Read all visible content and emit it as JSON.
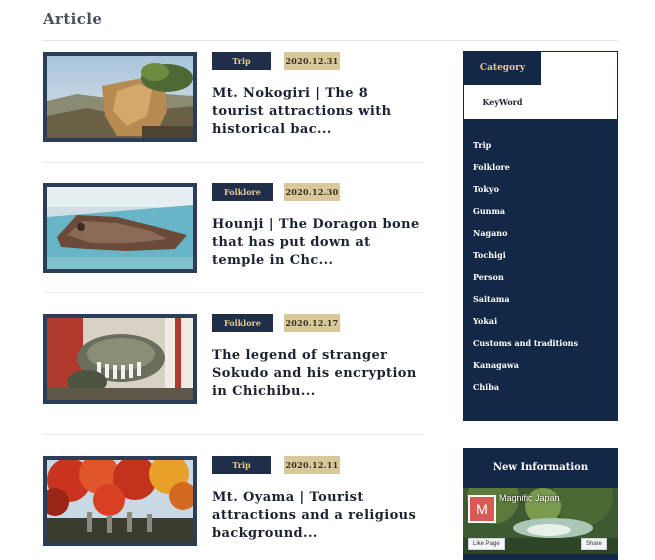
{
  "section": {
    "title": "Article"
  },
  "articles": [
    {
      "category": "Trip",
      "date": "2020.12.31",
      "title": "Mt. Nokogiri | The 8 tourist attractions with historical bac..."
    },
    {
      "category": "Folklore",
      "date": "2020.12.30",
      "title": "Hounji | The Doragon bone that has put down at temple in Chc..."
    },
    {
      "category": "Folklore",
      "date": "2020.12.17",
      "title": "The legend of stranger Sokudo and his encryption in Chichibu..."
    },
    {
      "category": "Trip",
      "date": "2020.12.11",
      "title": "Mt. Oyama | Tourist attractions and a religious background..."
    }
  ],
  "sidebar": {
    "tabs": {
      "category": "Category",
      "keyword": "KeyWord"
    },
    "categories": [
      "Trip",
      "Folklore",
      "Tokyo",
      "Gunma",
      "Nagano",
      "Tochigi",
      "Person",
      "Saitama",
      "Yokai",
      "Customs and traditions",
      "Kanagawa",
      "Chiba"
    ],
    "new_info": {
      "title": "New Information",
      "page_name": "Magnific Japan",
      "avatar_letter": "M",
      "like_label": "Like Page",
      "share_label": "Share"
    }
  },
  "colors": {
    "navy": "#132746",
    "gold": "#e6c98f",
    "date_badge": "#d9c89a"
  }
}
